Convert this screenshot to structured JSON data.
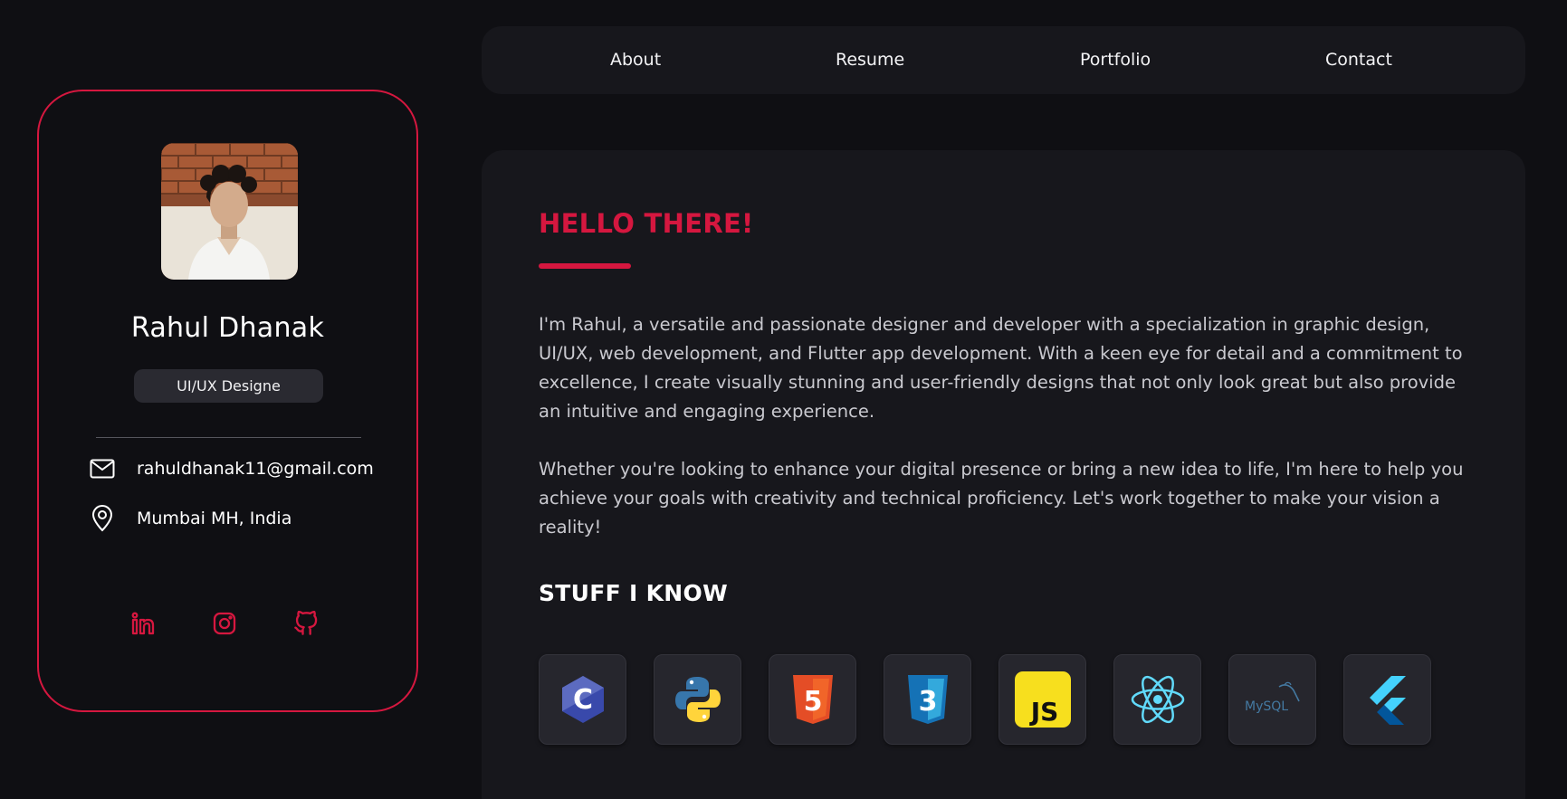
{
  "profile": {
    "name": "Rahul Dhanak",
    "role": "UI/UX Designe",
    "email": "rahuldhanak11@gmail.com",
    "location": "Mumbai MH, India",
    "socials": [
      "linkedin-icon",
      "instagram-icon",
      "github-icon"
    ]
  },
  "nav": {
    "items": [
      "About",
      "Resume",
      "Portfolio",
      "Contact"
    ]
  },
  "main": {
    "greeting": "HELLO THERE!",
    "paragraphs": [
      "I'm Rahul, a versatile and passionate designer and developer with a specialization in graphic design, UI/UX, web development, and Flutter app development. With a keen eye for detail and a commitment to excellence, I create visually stunning and user-friendly designs that not only look great but also provide an intuitive and engaging experience.",
      "Whether you're looking to enhance your digital presence or bring a new idea to life, I'm here to help you achieve your goals with creativity and technical proficiency. Let's work together to make your vision a reality!"
    ],
    "skills_title": "STUFF I KNOW",
    "skills": [
      {
        "icon": "c-lang-icon",
        "label": "C"
      },
      {
        "icon": "python-icon",
        "label": ""
      },
      {
        "icon": "html5-icon",
        "label": "5"
      },
      {
        "icon": "css3-icon",
        "label": "3"
      },
      {
        "icon": "javascript-icon",
        "label": "JS"
      },
      {
        "icon": "react-icon",
        "label": ""
      },
      {
        "icon": "mysql-icon",
        "label": "MySQL"
      },
      {
        "icon": "flutter-icon",
        "label": ""
      }
    ]
  },
  "colors": {
    "background": "#0f0f13",
    "panel": "#17171c",
    "accent": "#d5173f",
    "chip": "#2a2a31"
  }
}
